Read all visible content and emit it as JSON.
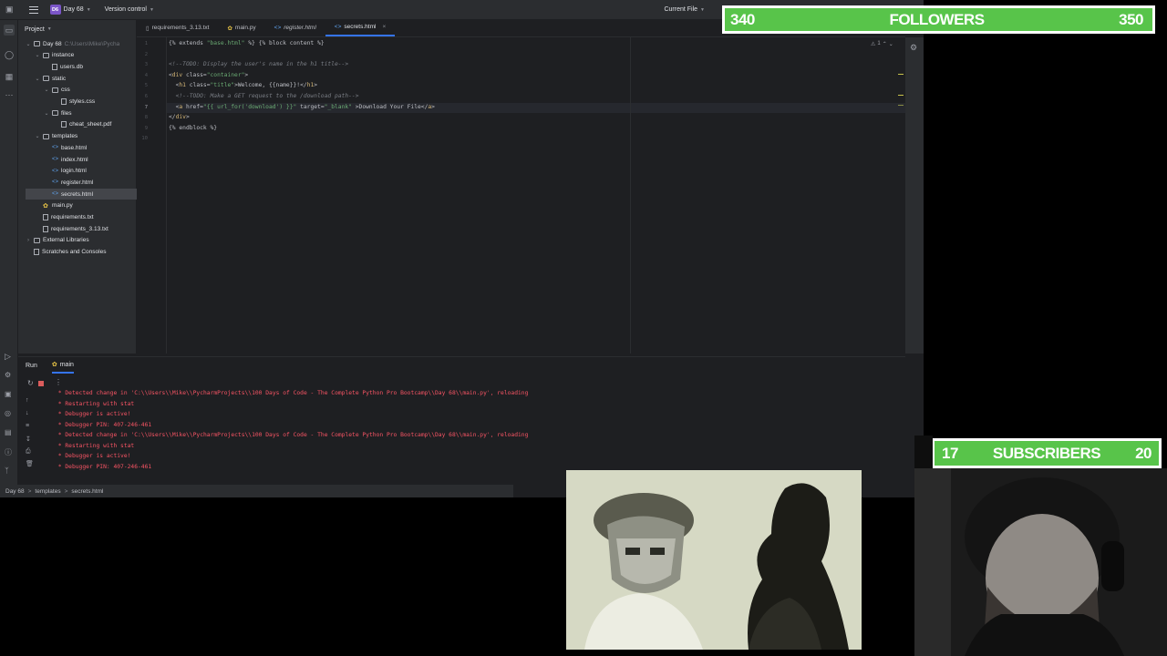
{
  "topbar": {
    "project_badge": "D6",
    "project_name": "Day 68",
    "vcs_label": "Version control",
    "run_config": "Current File"
  },
  "project_panel": {
    "title": "Project",
    "tree": [
      {
        "label": "Day 68",
        "extra": "C:\\Users\\Mike\\Pycha",
        "type": "folder",
        "depth": 0,
        "open": true
      },
      {
        "label": "instance",
        "type": "folder",
        "depth": 1,
        "open": true
      },
      {
        "label": "users.db",
        "type": "file",
        "depth": 2
      },
      {
        "label": "static",
        "type": "folder",
        "depth": 1,
        "open": true
      },
      {
        "label": "css",
        "type": "folder",
        "depth": 2,
        "open": true
      },
      {
        "label": "styles.css",
        "type": "file",
        "depth": 3
      },
      {
        "label": "files",
        "type": "folder",
        "depth": 2,
        "open": true
      },
      {
        "label": "cheat_sheet.pdf",
        "type": "file",
        "depth": 3
      },
      {
        "label": "templates",
        "type": "folder",
        "depth": 1,
        "open": true
      },
      {
        "label": "base.html",
        "type": "html",
        "depth": 2
      },
      {
        "label": "index.html",
        "type": "html",
        "depth": 2
      },
      {
        "label": "login.html",
        "type": "html",
        "depth": 2
      },
      {
        "label": "register.html",
        "type": "html",
        "depth": 2
      },
      {
        "label": "secrets.html",
        "type": "html",
        "depth": 2,
        "selected": true
      },
      {
        "label": "main.py",
        "type": "py",
        "depth": 1
      },
      {
        "label": "requirements.txt",
        "type": "file",
        "depth": 1
      },
      {
        "label": "requirements_3.13.txt",
        "type": "file",
        "depth": 1
      },
      {
        "label": "External Libraries",
        "type": "lib",
        "depth": 0
      },
      {
        "label": "Scratches and Consoles",
        "type": "scratch",
        "depth": 0
      }
    ]
  },
  "tabs": [
    {
      "label": "requirements_3.13.txt",
      "italic": false,
      "active": false
    },
    {
      "label": "main.py",
      "italic": false,
      "active": false
    },
    {
      "label": "register.html",
      "italic": true,
      "active": false
    },
    {
      "label": "secrets.html",
      "italic": false,
      "active": true
    }
  ],
  "code_lines": [
    "{% extends \"base.html\" %} {% block content %}",
    "",
    "<!--TODO: Display the user's name in the h1 title-->",
    "<div class=\"container\">",
    "  <h1 class=\"title\">Welcome, {{name}}!</h1>",
    "  <!--TODO: Make a GET request to the /download path-->",
    "  <a href=\"{{ url_for('download') }}\" target=\"_blank\" >Download Your File</a>",
    "</div>",
    "{% endblock %}",
    ""
  ],
  "inspection_count": "1",
  "run": {
    "tab_label": "Run",
    "config_label": "main",
    "console_lines": [
      " * Detected change in 'C:\\\\Users\\\\Mike\\\\PycharmProjects\\\\100 Days of Code - The Complete Python Pro Bootcamp\\\\Day 68\\\\main.py', reloading",
      " * Restarting with stat",
      " * Debugger is active!",
      " * Debugger PIN: 407-246-461",
      " * Detected change in 'C:\\\\Users\\\\Mike\\\\PycharmProjects\\\\100 Days of Code - The Complete Python Pro Bootcamp\\\\Day 68\\\\main.py', reloading",
      " * Restarting with stat",
      " * Debugger is active!",
      " * Debugger PIN: 407-246-461"
    ]
  },
  "breadcrumb": [
    "Day 68",
    "templates",
    "secrets.html"
  ],
  "overlay": {
    "followers": {
      "current": "340",
      "label": "FOLLOWERS",
      "goal": "350"
    },
    "subscribers": {
      "current": "17",
      "label": "SUBSCRIBERS",
      "goal": "20"
    }
  },
  "colors": {
    "accent": "#3574f0",
    "counter_green": "#58c44a",
    "console_red": "#f75464",
    "ide_bg": "#1e1f22"
  }
}
